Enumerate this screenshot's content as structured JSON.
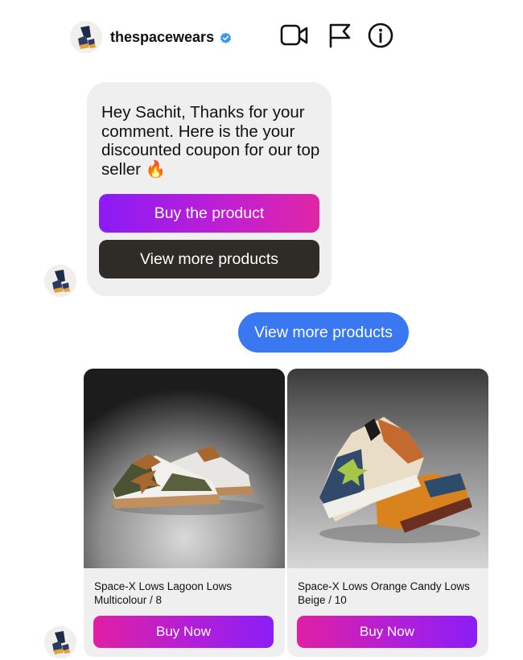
{
  "header": {
    "username": "thespacewears",
    "icons": [
      "avatar",
      "verified-badge-icon",
      "video-call-icon",
      "flag-icon",
      "info-icon"
    ]
  },
  "conversation": {
    "incoming_message": {
      "text": "Hey Sachit, Thanks for your comment. Here is the your discounted coupon for our top seller 🔥",
      "buy_button_label": "Buy the product",
      "more_button_label": "View more products"
    },
    "outgoing_message": {
      "text": "View more products"
    },
    "products": [
      {
        "title": "Space-X Lows Lagoon Lows Multicolour / 8",
        "button_label": "Buy Now"
      },
      {
        "title": "Space-X Lows Orange Candy Lows Beige / 10",
        "button_label": "Buy Now"
      }
    ]
  },
  "colors": {
    "incoming_bubble": "#efefef",
    "outgoing_bubble": "#3a78f2",
    "buy_gradient_start": "#8a1bf7",
    "buy_gradient_end": "#e126a6",
    "dark_button": "#2f2c28",
    "verified_blue": "#3897f0"
  }
}
